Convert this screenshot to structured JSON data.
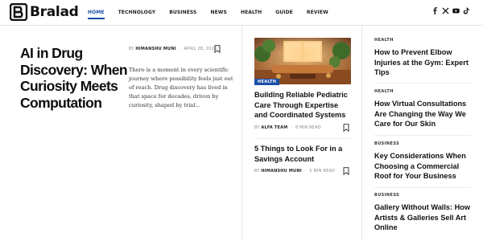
{
  "brand": {
    "name": "Bralad"
  },
  "nav": {
    "items": [
      {
        "label": "HOME",
        "active": true
      },
      {
        "label": "TECHNOLOGY",
        "active": false
      },
      {
        "label": "BUSINESS",
        "active": false
      },
      {
        "label": "NEWS",
        "active": false
      },
      {
        "label": "HEALTH",
        "active": false
      },
      {
        "label": "GUIDE",
        "active": false
      },
      {
        "label": "REVIEW",
        "active": false
      }
    ]
  },
  "social": [
    "facebook-icon",
    "x-icon",
    "youtube-icon",
    "tiktok-icon"
  ],
  "colors": {
    "accent": "#1a4fa8",
    "text": "#111111",
    "muted": "#888888"
  },
  "hero": {
    "title": "AI in Drug Discovery: When Curiosity Meets Computation",
    "by": "BY",
    "author": "HIMANSHU MUNI",
    "date": "APRIL 28, 2026",
    "excerpt": "There is a moment in every scientific journey where possibility feels just out of reach. Drug discovery has lived in that space for decades, driven by curiosity, shaped by trial..."
  },
  "middle": {
    "featured": {
      "category": "HEALTH",
      "title": "Building Reliable Pediatric Care Through Expertise and Coordinated Systems",
      "by": "BY",
      "author": "ALFA TEAM",
      "read_time": "8 MIN READ"
    },
    "second": {
      "title": "5 Things to Look For in a Savings Account",
      "by": "BY",
      "author": "HIMANSHU MUNI",
      "read_time": "5 MIN READ"
    }
  },
  "right": {
    "items": [
      {
        "category": "HEALTH",
        "title": "How to Prevent Elbow Injuries at the Gym: Expert Tips"
      },
      {
        "category": "HEALTH",
        "title": "How Virtual Consultations Are Changing the Way We Care for Our Skin"
      },
      {
        "category": "BUSINESS",
        "title": "Key Considerations When Choosing a Commercial Roof for Your Business"
      },
      {
        "category": "BUSINESS",
        "title": "Gallery Without Walls: How Artists & Galleries Sell Art Online"
      }
    ]
  }
}
